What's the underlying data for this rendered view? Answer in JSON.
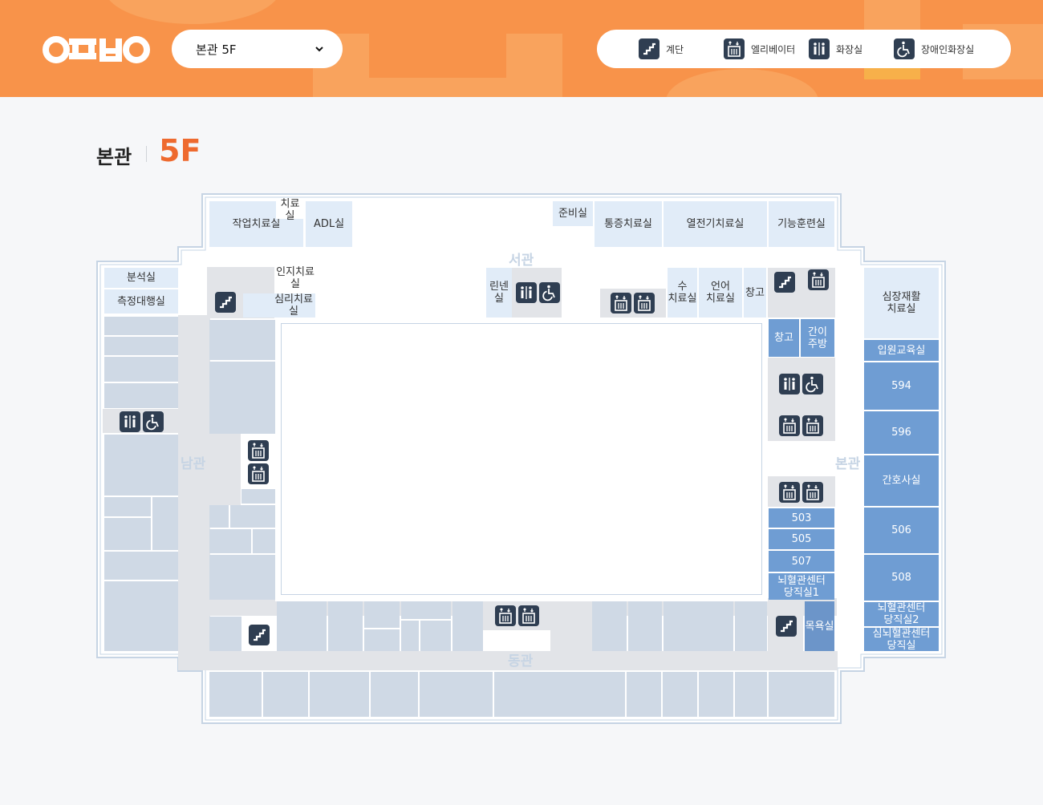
{
  "header": {
    "logo_icon": "hospital-logo",
    "floor_select": {
      "value": "본관 5F"
    },
    "legend": [
      {
        "icon": "stairs-icon",
        "label": "계단"
      },
      {
        "icon": "elevator-icon",
        "label": "엘리베이터"
      },
      {
        "icon": "restroom-icon",
        "label": "화장실"
      },
      {
        "icon": "accessible-restroom-icon",
        "label": "장애인화장실"
      }
    ],
    "colors": {
      "brand_orange": "#f8934a",
      "icon_dark": "#2f3e52"
    }
  },
  "title": {
    "building": "본관",
    "floor": "5F",
    "floor_color": "#ee6a2f"
  },
  "map": {
    "wings": {
      "west": "서관",
      "south": "남관",
      "main": "본관",
      "east": "동관"
    },
    "rooms": {
      "occupational_therapy": "작업치료실",
      "therapy_room_top": "치료실",
      "adl_room": "ADL실",
      "prep_room": "준비실",
      "pain_therapy": "통증치료실",
      "thermo_therapy": "열전기치료실",
      "function_training": "기능훈련실",
      "analysis_room": "분석실",
      "measurement_room": "측정대행실",
      "cognitive_therapy": "인지치료실",
      "psych_therapy": "심리치료실",
      "linen_room": "린넨실",
      "water_therapy": "수\n치료실",
      "speech_therapy": "언어\n치료실",
      "storage_1": "창고",
      "storage_2": "창고",
      "kitchenette": "간이\n주방",
      "cardiac_rehab": "심장재활\n치료실",
      "inpatient_edu": "입원교육실",
      "room_594": "594",
      "room_596": "596",
      "nurse_station": "간호사실",
      "room_506": "506",
      "room_508": "508",
      "room_503": "503",
      "room_505": "505",
      "room_507": "507",
      "stroke_duty_1": "뇌혈관센터\n당직실1",
      "stroke_duty_2": "뇌혈관센터\n당직실2",
      "cardio_duty": "심뇌혈관센터\n당직실",
      "bathroom": "목욕실"
    }
  }
}
